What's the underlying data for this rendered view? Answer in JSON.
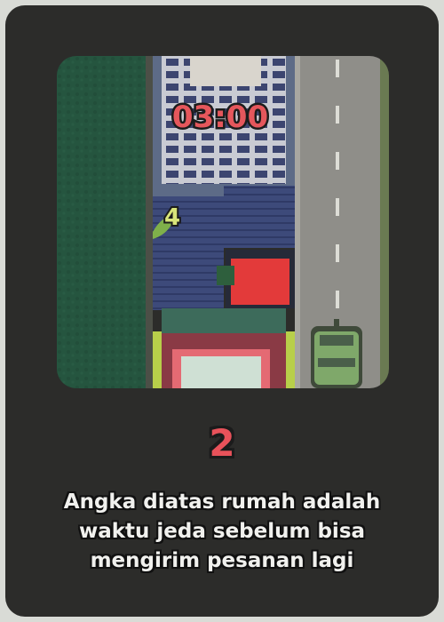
{
  "scene": {
    "timer": "03:00",
    "house_cooldown": "4",
    "colors": {
      "grass": "#25553f",
      "road": "#8f8e89",
      "timer_fill": "#e5575c",
      "cooldown_fill": "#d9e57a",
      "car": "#7fa86a"
    }
  },
  "step_number": "2",
  "caption_lines": [
    "Angka diatas rumah adalah",
    "waktu jeda sebelum bisa",
    "mengirim pesanan lagi"
  ]
}
